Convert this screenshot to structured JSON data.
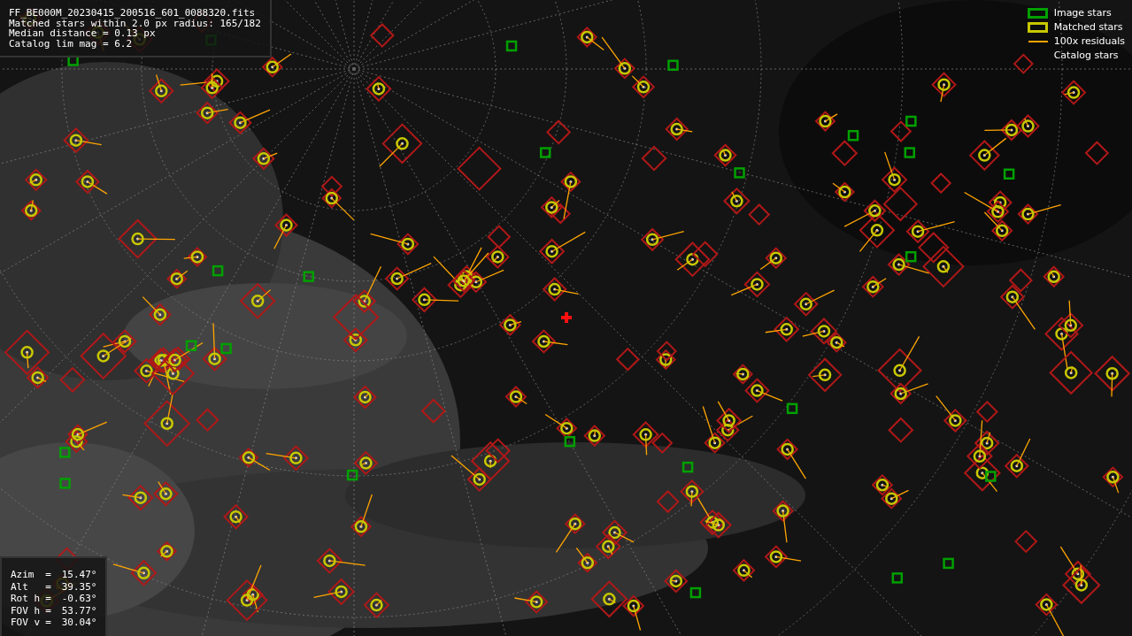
{
  "info_panel": {
    "lines": [
      "FF_BE000M_20230415_200516_601_0088320.fits",
      "Matched stars within 2.0 px radius: 165/182",
      "Median distance = 0.13 px",
      "Catalog lim mag = 6.2"
    ]
  },
  "pointing_panel": {
    "rows": [
      {
        "label": "Azim",
        "sign": "=",
        "value": "15.47°"
      },
      {
        "label": "Alt",
        "sign": "=",
        "value": "39.35°"
      },
      {
        "label": "Rot h",
        "sign": "=",
        "value": "-0.63°"
      },
      {
        "label": "FOV h",
        "sign": "=",
        "value": "53.77°"
      },
      {
        "label": "FOV v",
        "sign": "=",
        "value": "30.04°"
      }
    ]
  },
  "legend": [
    {
      "kind": "box",
      "label": "Image stars",
      "color": "#00a000"
    },
    {
      "kind": "box",
      "label": "Matched stars",
      "color": "#c8c800"
    },
    {
      "kind": "line",
      "label": "100x residuals",
      "color": "#ffa500"
    },
    {
      "kind": "none",
      "label": "Catalog stars"
    }
  ]
}
